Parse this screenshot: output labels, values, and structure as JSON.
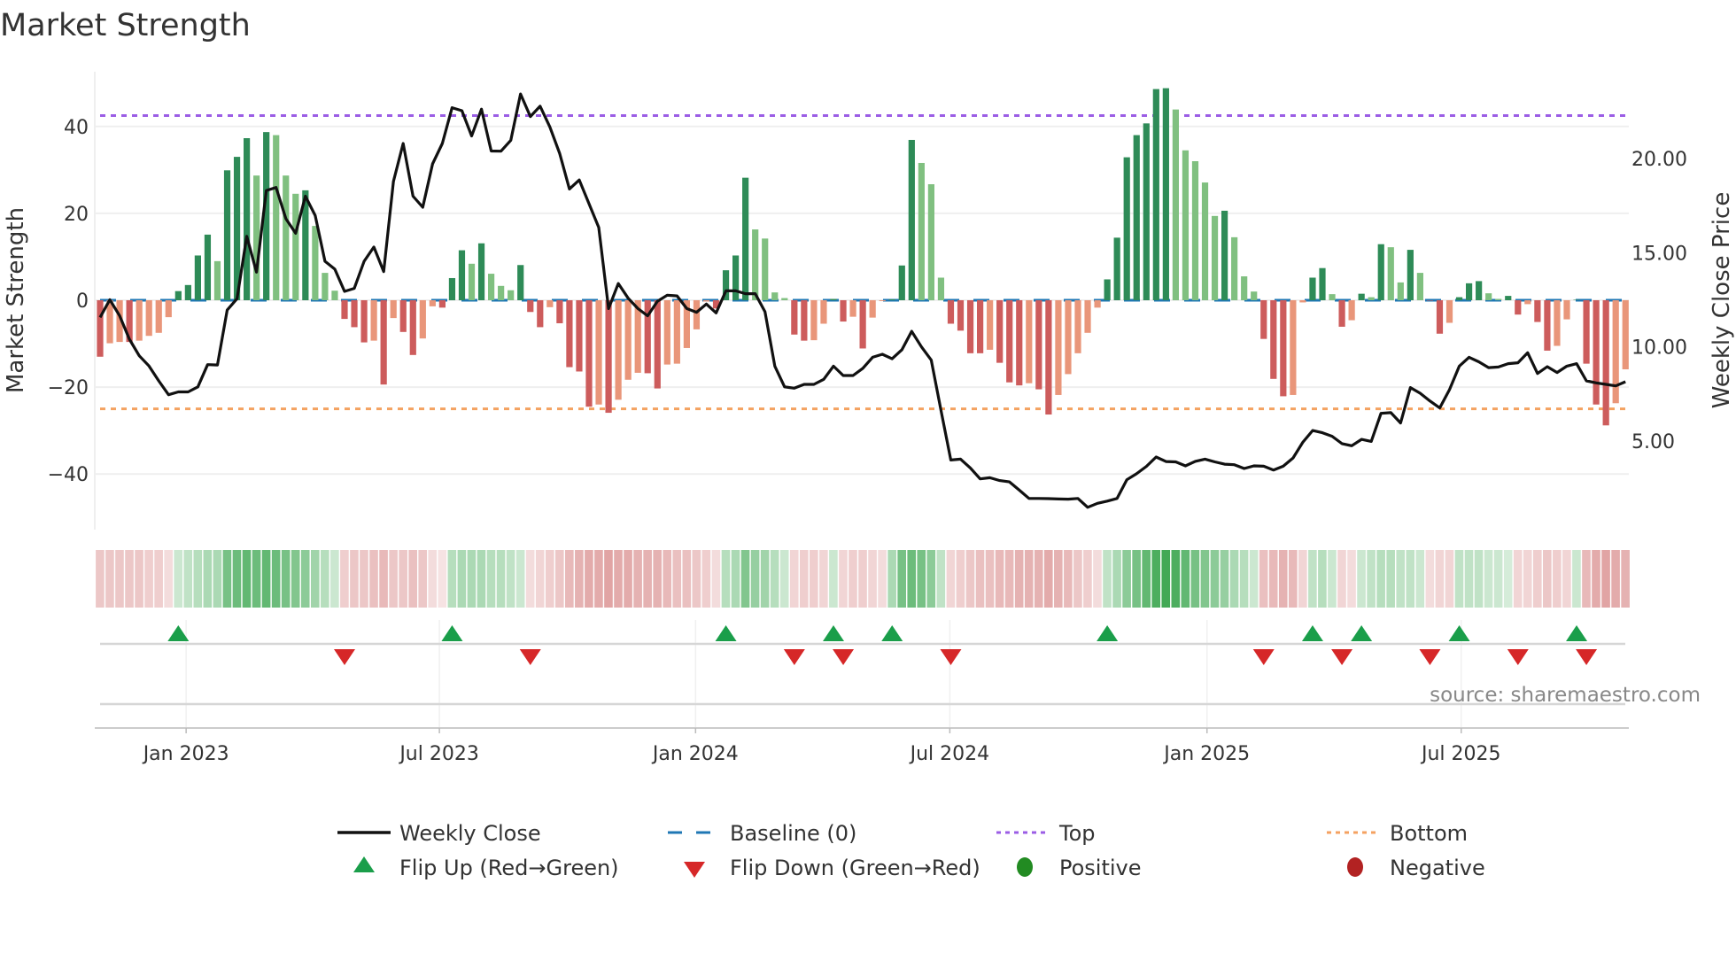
{
  "chart_data": {
    "type": "bar",
    "title": "Market Strength",
    "ylabel": "Market Strength",
    "y2label": "Weekly Close Price",
    "ylim": [
      -53,
      52
    ],
    "y_ticks": [
      {
        "v": 40,
        "label": "40"
      },
      {
        "v": 20,
        "label": "20"
      },
      {
        "v": 0,
        "label": "0"
      },
      {
        "v": -20,
        "label": "−20"
      },
      {
        "v": -40,
        "label": "−40"
      }
    ],
    "y2_ticks": [
      {
        "v": 20,
        "label": "20.00"
      },
      {
        "v": 15,
        "label": "15.00"
      },
      {
        "v": 10,
        "label": "10.00"
      },
      {
        "v": 5,
        "label": "5.00"
      }
    ],
    "x_ticks": [
      {
        "week": 8.8,
        "label": "Jan 2023"
      },
      {
        "week": 34.7,
        "label": "Jul 2023"
      },
      {
        "week": 60.9,
        "label": "Jan 2024"
      },
      {
        "week": 86.9,
        "label": "Jul 2024"
      },
      {
        "week": 113.2,
        "label": "Jan 2025"
      },
      {
        "week": 139.2,
        "label": "Jul 2025"
      }
    ],
    "top_level": 42.5,
    "bottom_level": -25,
    "baseline": 0,
    "grid": true,
    "strength": [
      -13.0,
      -9.9,
      -9.6,
      -9.6,
      -9.3,
      -8.2,
      -7.5,
      -3.9,
      2.1,
      3.5,
      10.3,
      15.1,
      9.0,
      29.9,
      33.0,
      37.3,
      28.7,
      38.7,
      38.0,
      28.7,
      24.5,
      25.3,
      17.1,
      6.3,
      2.2,
      -4.3,
      -6.2,
      -9.7,
      -9.3,
      -19.4,
      -4.1,
      -7.3,
      -12.6,
      -8.8,
      -1.4,
      -1.7,
      5.1,
      11.5,
      8.4,
      13.1,
      6.1,
      3.3,
      2.3,
      8.1,
      -2.7,
      -6.2,
      -1.6,
      -5.3,
      -15.4,
      -16.4,
      -24.5,
      -24.0,
      -25.9,
      -22.9,
      -18.3,
      -16.7,
      -16.8,
      -20.3,
      -14.8,
      -14.6,
      -11.0,
      -6.7,
      -0.3,
      -1.9,
      6.9,
      10.3,
      28.2,
      16.3,
      14.2,
      1.8,
      0.5,
      -7.9,
      -9.3,
      -9.2,
      -5.4,
      0.3,
      -4.9,
      -3.8,
      -11.1,
      -4.0,
      -0.2,
      0.2,
      8.0,
      36.9,
      31.6,
      26.7,
      5.2,
      -5.4,
      -7.0,
      -12.2,
      -12.2,
      -11.4,
      -14.4,
      -18.9,
      -19.6,
      -19.1,
      -20.5,
      -26.3,
      -21.8,
      -17.0,
      -12.2,
      -7.5,
      -1.7,
      4.8,
      14.4,
      32.9,
      38.0,
      40.7,
      48.6,
      48.8,
      43.9,
      34.5,
      32.0,
      27.1,
      19.4,
      20.6,
      14.5,
      5.5,
      2.0,
      -8.9,
      -18.1,
      -22.1,
      -21.8,
      -0.5,
      5.2,
      7.4,
      1.4,
      -6.1,
      -4.6,
      1.5,
      0.7,
      12.9,
      12.2,
      4.1,
      11.6,
      6.3,
      -0.1,
      -7.7,
      -5.2,
      0.7,
      3.9,
      4.4,
      1.6,
      0.3,
      1.0,
      -3.3,
      -0.9,
      -5.0,
      -11.6,
      -10.5,
      -4.4,
      0.1,
      -14.6,
      -24.0,
      -28.8,
      -23.7,
      -15.9
    ],
    "weekly_close": [
      11.56,
      12.5,
      11.64,
      10.4,
      9.52,
      8.98,
      8.19,
      7.45,
      7.6,
      7.6,
      7.87,
      9.05,
      9.03,
      11.95,
      12.55,
      15.87,
      13.96,
      18.3,
      18.46,
      16.8,
      16.03,
      18.0,
      16.97,
      14.54,
      14.12,
      12.94,
      13.1,
      14.54,
      15.3,
      13.99,
      18.78,
      20.8,
      18.0,
      17.41,
      19.72,
      20.8,
      22.7,
      22.54,
      21.2,
      22.62,
      20.4,
      20.39,
      20.97,
      23.43,
      22.23,
      22.78,
      21.68,
      20.27,
      18.38,
      18.86,
      17.6,
      16.34,
      12.03,
      13.36,
      12.58,
      12.03,
      11.64,
      12.42,
      12.74,
      12.7,
      12.03,
      11.83,
      12.27,
      11.8,
      12.97,
      12.97,
      12.82,
      12.82,
      11.86,
      8.97,
      7.87,
      7.8,
      8.0,
      8.0,
      8.27,
      8.97,
      8.47,
      8.47,
      8.85,
      9.44,
      9.6,
      9.36,
      9.84,
      10.82,
      9.99,
      9.29,
      6.62,
      3.98,
      4.03,
      3.56,
      2.98,
      3.04,
      2.89,
      2.82,
      2.38,
      1.94,
      1.94,
      1.93,
      1.91,
      1.9,
      1.94,
      1.47,
      1.68,
      1.8,
      1.94,
      2.93,
      3.25,
      3.64,
      4.14,
      3.9,
      3.88,
      3.67,
      3.91,
      4.03,
      3.88,
      3.76,
      3.73,
      3.53,
      3.67,
      3.65,
      3.45,
      3.65,
      4.09,
      4.92,
      5.55,
      5.43,
      5.24,
      4.85,
      4.74,
      5.08,
      4.97,
      6.46,
      6.5,
      5.95,
      7.83,
      7.53,
      7.12,
      6.75,
      7.72,
      8.97,
      9.44,
      9.2,
      8.89,
      8.92,
      9.1,
      9.15,
      9.68,
      8.58,
      8.94,
      8.63,
      8.97,
      9.1,
      8.19,
      8.08,
      8.0,
      7.92,
      8.14
    ],
    "regime_intensity": [
      -0.3,
      -0.3,
      -0.3,
      -0.3,
      -0.3,
      -0.25,
      -0.25,
      -0.15,
      0.15,
      0.2,
      0.25,
      0.3,
      0.3,
      0.55,
      0.6,
      0.65,
      0.6,
      0.65,
      0.6,
      0.55,
      0.5,
      0.45,
      0.35,
      0.25,
      0.15,
      -0.25,
      -0.3,
      -0.3,
      -0.35,
      -0.4,
      -0.3,
      -0.3,
      -0.35,
      -0.3,
      -0.15,
      -0.1,
      0.25,
      0.3,
      0.3,
      0.3,
      0.25,
      0.25,
      0.2,
      0.15,
      -0.15,
      -0.2,
      -0.25,
      -0.3,
      -0.4,
      -0.45,
      -0.5,
      -0.5,
      -0.55,
      -0.5,
      -0.5,
      -0.45,
      -0.45,
      -0.45,
      -0.4,
      -0.35,
      -0.35,
      -0.3,
      -0.25,
      -0.15,
      0.25,
      0.3,
      0.5,
      0.4,
      0.35,
      0.25,
      0.15,
      -0.2,
      -0.25,
      -0.25,
      -0.2,
      0.15,
      -0.2,
      -0.25,
      -0.25,
      -0.2,
      -0.15,
      0.3,
      0.55,
      0.6,
      0.55,
      0.45,
      0.2,
      -0.2,
      -0.25,
      -0.3,
      -0.35,
      -0.35,
      -0.4,
      -0.4,
      -0.45,
      -0.45,
      -0.45,
      -0.5,
      -0.45,
      -0.4,
      -0.3,
      -0.25,
      -0.15,
      0.2,
      0.3,
      0.45,
      0.55,
      0.65,
      0.75,
      0.8,
      0.75,
      0.65,
      0.55,
      0.5,
      0.45,
      0.4,
      0.3,
      0.25,
      0.15,
      -0.35,
      -0.4,
      -0.45,
      -0.4,
      -0.2,
      0.2,
      0.25,
      0.15,
      -0.2,
      -0.15,
      0.15,
      0.2,
      0.25,
      0.25,
      0.2,
      0.2,
      0.15,
      -0.15,
      -0.2,
      -0.2,
      0.2,
      0.2,
      0.2,
      0.15,
      0.15,
      0.1,
      -0.2,
      -0.2,
      -0.25,
      -0.3,
      -0.25,
      -0.2,
      0.15,
      -0.4,
      -0.5,
      -0.55,
      -0.5,
      -0.45
    ],
    "flip_up_weeks": [
      8,
      36,
      64,
      75,
      81,
      103,
      124,
      129,
      139,
      151
    ],
    "flip_down_weeks": [
      25,
      44,
      71,
      76,
      87,
      119,
      127,
      136,
      145,
      152
    ],
    "legend": [
      {
        "key": "close",
        "label": "Weekly Close"
      },
      {
        "key": "baseline",
        "label": "Baseline (0)"
      },
      {
        "key": "top",
        "label": "Top"
      },
      {
        "key": "bottom",
        "label": "Bottom"
      },
      {
        "key": "flipup",
        "label": "Flip Up (Red→Green)"
      },
      {
        "key": "flipdown",
        "label": "Flip Down (Green→Red)"
      },
      {
        "key": "positive",
        "label": "Positive"
      },
      {
        "key": "negative",
        "label": "Negative"
      }
    ],
    "legend_placement": "bottom",
    "source": "source: sharemaestro.com",
    "colors": {
      "pos_strong": "#2e8b57",
      "pos_weak": "#80c080",
      "neg_strong": "#cd5c5c",
      "neg_weak": "#e9967a",
      "close": "#111111",
      "baseline": "#1f77b4",
      "top": "#9b5de5",
      "bottom": "#f4a261",
      "flip_up": "#1a9e4a",
      "flip_down": "#d62728",
      "positive": "#228b22",
      "negative": "#b22222"
    }
  }
}
